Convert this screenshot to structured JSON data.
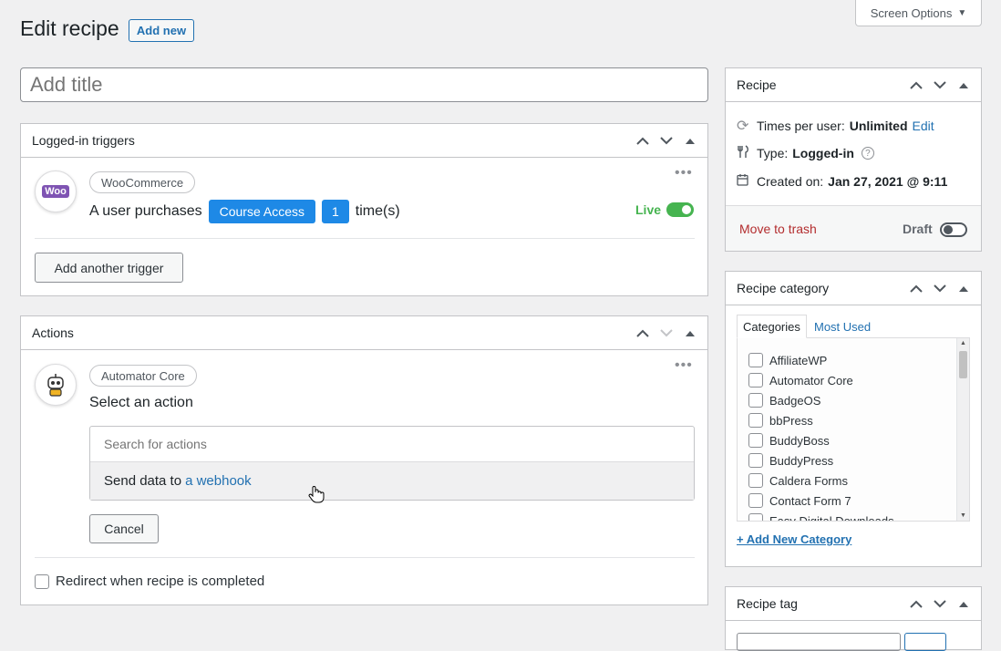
{
  "header": {
    "title": "Edit recipe",
    "add_new": "Add new",
    "screen_options": "Screen Options"
  },
  "title_input": {
    "placeholder": "Add title",
    "value": ""
  },
  "triggers": {
    "heading": "Logged-in triggers",
    "integration": "WooCommerce",
    "sentence_prefix": "A user purchases",
    "token_product": "Course Access",
    "token_count": "1",
    "sentence_suffix": "time(s)",
    "status": "Live",
    "add_button": "Add another trigger",
    "woo_logo_text": "Woo"
  },
  "actions": {
    "heading": "Actions",
    "integration": "Automator Core",
    "prompt": "Select an action",
    "search_placeholder": "Search for actions",
    "result_prefix": "Send data to",
    "result_link": "a webhook",
    "cancel": "Cancel",
    "redirect_label": "Redirect when recipe is completed"
  },
  "recipe_box": {
    "heading": "Recipe",
    "times_label": "Times per user:",
    "times_value": "Unlimited",
    "edit": "Edit",
    "type_label": "Type:",
    "type_value": "Logged-in",
    "created_label": "Created on:",
    "created_value": "Jan 27, 2021 @ 9:11",
    "trash": "Move to trash",
    "draft": "Draft"
  },
  "category_box": {
    "heading": "Recipe category",
    "tab_all": "Categories",
    "tab_used": "Most Used",
    "items": [
      "AffiliateWP",
      "Automator Core",
      "BadgeOS",
      "bbPress",
      "BuddyBoss",
      "BuddyPress",
      "Caldera Forms",
      "Contact Form 7",
      "Easy Digital Downloads"
    ],
    "add_new": "+ Add New Category"
  },
  "tag_box": {
    "heading": "Recipe tag"
  },
  "colors": {
    "accent": "#2271b1",
    "token": "#1e89e6",
    "live": "#46b450",
    "trash": "#b32d2e"
  }
}
